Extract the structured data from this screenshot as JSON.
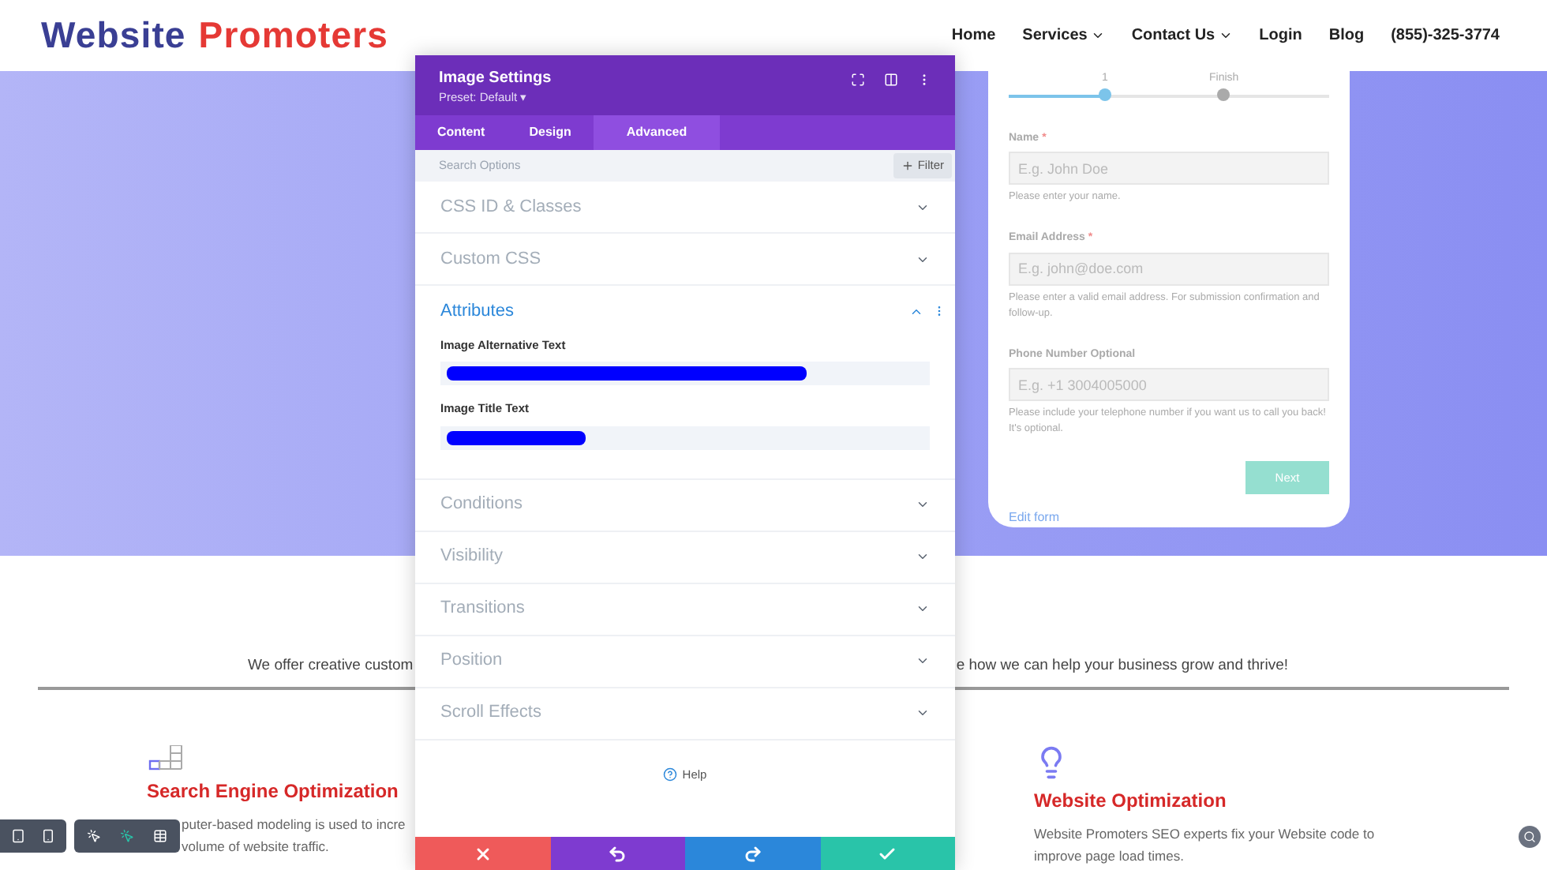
{
  "header": {
    "logo": {
      "part_1": "Website",
      "part_2": "Promoters"
    },
    "nav": [
      {
        "label": "Home",
        "has_menu": false
      },
      {
        "label": "Services",
        "has_menu": true
      },
      {
        "label": "Contact Us",
        "has_menu": true
      },
      {
        "label": "Login",
        "has_menu": false
      },
      {
        "label": "Blog",
        "has_menu": false
      },
      {
        "label": "(855)-325-3774",
        "has_menu": false
      }
    ]
  },
  "form": {
    "steps": [
      {
        "label": "1",
        "selected": true
      },
      {
        "label": "Finish",
        "selected": false
      }
    ],
    "fields": [
      {
        "label": "Name",
        "required_mark": "*",
        "placeholder": "E.g. John Doe",
        "help": "Please enter your name."
      },
      {
        "label": "Email Address",
        "required_mark": "*",
        "placeholder": "E.g. john@doe.com",
        "help": "Please enter a valid email address. For submission confirmation and follow-up."
      },
      {
        "label": "Phone Number Optional",
        "placeholder": "E.g. +1 3004005000",
        "help": "Please include your telephone number if you want us to call you back! It's optional."
      }
    ],
    "submit": "Next",
    "edit_link": "Edit form"
  },
  "intro": {
    "left": "We offer creative custom",
    "right": "e how we can help your business grow and thrive!"
  },
  "services": [
    {
      "title": "Search Engine Optimization",
      "text": "puter-based modeling is used to incre",
      "text_2": "volume of website traffic."
    },
    {
      "title": "Website Optimization",
      "text": "Website Promoters SEO experts fix your Website code to",
      "text_2": "improve page load times."
    }
  ],
  "modal": {
    "title": "Image Settings",
    "preset": "Preset: Default",
    "preset_caret": "▾",
    "tabs": [
      {
        "label": "Content",
        "selected": false
      },
      {
        "label": "Design",
        "selected": false
      },
      {
        "label": "Advanced",
        "selected": true
      }
    ],
    "search_placeholder": "Search Options",
    "filter": "Filter",
    "sections": [
      {
        "title": "CSS ID & Classes",
        "expanded": false
      },
      {
        "title": "Custom CSS",
        "expanded": false
      },
      {
        "title": "Attributes",
        "expanded": true,
        "fields": [
          {
            "label": "Image Alternative Text",
            "redacted": true
          },
          {
            "label": "Image Title Text",
            "redacted": true
          }
        ]
      },
      {
        "title": "Conditions",
        "expanded": false
      },
      {
        "title": "Visibility",
        "expanded": false
      },
      {
        "title": "Transitions",
        "expanded": false
      },
      {
        "title": "Position",
        "expanded": false
      },
      {
        "title": "Scroll Effects",
        "expanded": false
      }
    ],
    "help": "Help",
    "actions": [
      {
        "kind": "cancel",
        "color": "#ef5a5a"
      },
      {
        "kind": "undo",
        "color": "#7e3bd0"
      },
      {
        "kind": "redo",
        "color": "#2b87da"
      },
      {
        "kind": "save",
        "color": "#29c4a9"
      }
    ]
  }
}
